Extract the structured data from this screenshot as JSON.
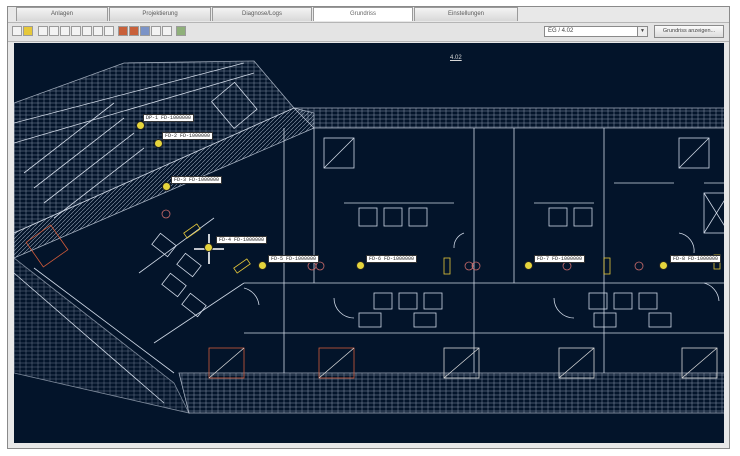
{
  "tabs": [
    {
      "label": "Anlagen"
    },
    {
      "label": "Projektierung"
    },
    {
      "label": "Diagnose/Logs"
    },
    {
      "label": "Grundriss"
    },
    {
      "label": "Einstellungen"
    }
  ],
  "toolbar": {
    "floor_value": "EG / 4.02",
    "show_button": "Grundriss anzeigen..."
  },
  "plan": {
    "scale_label": "4.02",
    "devices": [
      {
        "text": "DP-1 FD-1000000"
      },
      {
        "text": "FD-2 FD-1000000"
      },
      {
        "text": "FD-3 FD-1000000"
      },
      {
        "text": "FD-4 FD-1000000"
      },
      {
        "text": "FD-5 FD-1000000"
      },
      {
        "text": "FD-6 FD-1000000"
      },
      {
        "text": "FD-7 FD-1000000"
      },
      {
        "text": "FD-8 FD-1000000"
      }
    ]
  }
}
